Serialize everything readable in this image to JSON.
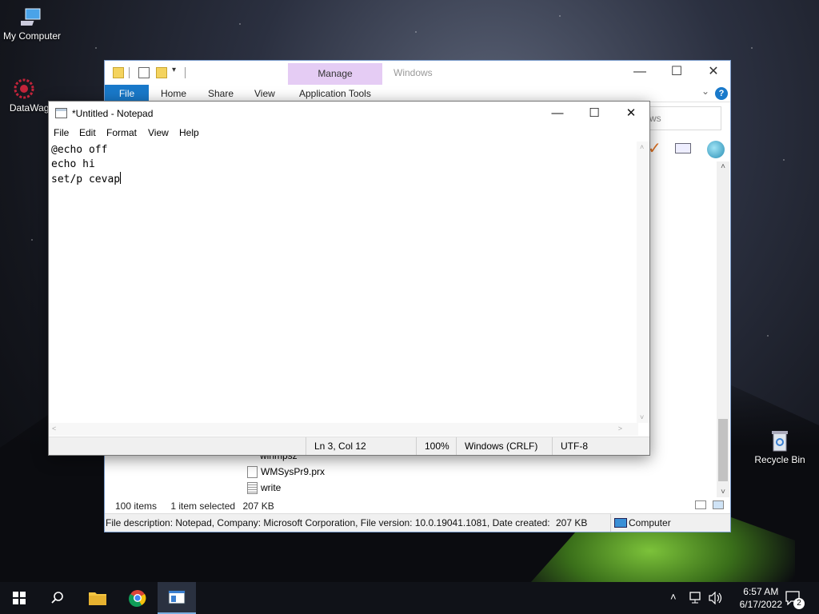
{
  "desktop": {
    "icons": [
      {
        "label": "My Computer"
      },
      {
        "label": "DataWago"
      },
      {
        "label": "Recycle Bin"
      }
    ]
  },
  "explorer": {
    "title": "Windows",
    "manage_tab": "Manage",
    "ribbon_tabs": [
      "File",
      "Home",
      "Share",
      "View",
      "Application Tools"
    ],
    "search_placeholder": "ws",
    "files": [
      "winmpsz",
      "WMSysPr9.prx",
      "write"
    ],
    "status": {
      "items": "100 items",
      "selected": "1 item selected",
      "size": "207 KB"
    },
    "details": {
      "description": "File description: Notepad, Company: Microsoft Corporation, File version: 10.0.19041.1081, Date created:",
      "size": "207 KB",
      "location": "Computer"
    }
  },
  "notepad": {
    "title": "*Untitled - Notepad",
    "menu": [
      "File",
      "Edit",
      "Format",
      "View",
      "Help"
    ],
    "lines": [
      "@echo off",
      "echo hi",
      "set/p cevap"
    ],
    "status": {
      "position": "Ln 3, Col 12",
      "zoom": "100%",
      "line_ending": "Windows (CRLF)",
      "encoding": "UTF-8"
    }
  },
  "taskbar": {
    "time": "6:57 AM",
    "date": "6/17/2022",
    "notification_count": "2"
  }
}
